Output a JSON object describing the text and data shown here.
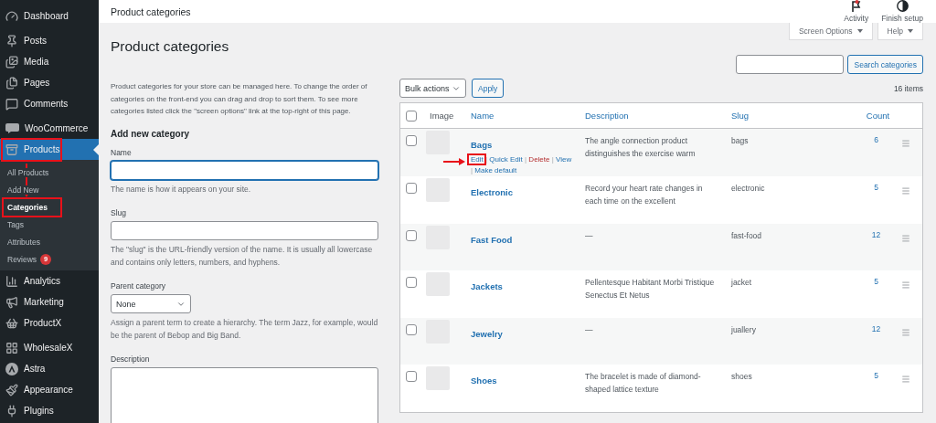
{
  "sidebar": {
    "groups": [
      [
        {
          "label": "Dashboard",
          "kind": "gauge",
          "selected": false,
          "highlighted": false
        }
      ],
      [
        {
          "label": "Posts",
          "kind": "pin",
          "selected": false,
          "highlighted": false
        },
        {
          "label": "Media",
          "kind": "media",
          "selected": false,
          "highlighted": false
        },
        {
          "label": "Pages",
          "kind": "pages",
          "selected": false,
          "highlighted": false
        },
        {
          "label": "Comments",
          "kind": "comment",
          "selected": false,
          "highlighted": false
        }
      ],
      [
        {
          "label": "WooCommerce",
          "kind": "store",
          "selected": false,
          "highlighted": false
        },
        {
          "label": "Products",
          "kind": "archive",
          "selected": true,
          "highlighted": true,
          "children": [
            {
              "label": "All Products",
              "selected": false,
              "highlighted": false
            },
            {
              "label": "Add New",
              "selected": false,
              "highlighted": false
            },
            {
              "label": "Categories",
              "selected": true,
              "highlighted": true
            },
            {
              "label": "Tags",
              "selected": false,
              "highlighted": false
            },
            {
              "label": "Attributes",
              "selected": false,
              "highlighted": false
            },
            {
              "label": "Reviews",
              "selected": false,
              "highlighted": false,
              "badge": "9"
            }
          ]
        },
        {
          "label": "Analytics",
          "kind": "chart",
          "selected": false,
          "highlighted": false
        },
        {
          "label": "Marketing",
          "kind": "megaphone",
          "selected": false,
          "highlighted": false
        },
        {
          "label": "ProductX",
          "kind": "basket",
          "selected": false,
          "highlighted": false
        }
      ],
      [
        {
          "label": "WholesaleX",
          "kind": "grid",
          "selected": false,
          "highlighted": false
        },
        {
          "label": "Astra",
          "kind": "astra",
          "selected": false,
          "highlighted": false
        },
        {
          "label": "Appearance",
          "kind": "brush",
          "selected": false,
          "highlighted": false
        },
        {
          "label": "Plugins",
          "kind": "plug",
          "selected": false,
          "highlighted": false
        }
      ]
    ]
  },
  "header": {
    "title": "Product categories",
    "actions": [
      {
        "label": "Activity",
        "kind": "activity"
      },
      {
        "label": "Finish setup",
        "kind": "setup"
      }
    ]
  },
  "screen_meta": [
    "Screen Options",
    "Help"
  ],
  "page_title": "Product categories",
  "search": {
    "button": "Search categories"
  },
  "intro": "Product categories for your store can be managed here. To change the order of categories on the front-end you can drag and drop to sort them. To see more categories listed click the \"screen options\" link at the top-right of this page.",
  "form": {
    "heading": "Add new category",
    "fields": [
      {
        "kind": "text",
        "label": "Name",
        "hint": "The name is how it appears on your site.",
        "focused": true
      },
      {
        "kind": "text",
        "label": "Slug",
        "hint": "The \"slug\" is the URL-friendly version of the name. It is usually all lowercase and contains only letters, numbers, and hyphens.",
        "focused": false
      },
      {
        "kind": "select",
        "label": "Parent category",
        "value": "None",
        "hint": "Assign a parent term to create a hierarchy. The term Jazz, for example, would be the parent of Bebop and Big Band."
      },
      {
        "kind": "textarea",
        "label": "Description"
      }
    ]
  },
  "table": {
    "select_all_checked": false,
    "bulk_action": "Bulk actions",
    "apply": "Apply",
    "count": "16 items",
    "separator": "|",
    "columns": [
      {
        "label": "Image",
        "sortable": false
      },
      {
        "label": "Name",
        "sortable": true
      },
      {
        "label": "Description",
        "sortable": true
      },
      {
        "label": "Slug",
        "sortable": true
      },
      {
        "label": "Count",
        "sortable": true
      }
    ],
    "rows": [
      {
        "name": "Bags",
        "checked": false,
        "description": "The angle connection product distinguishes the exercise warm",
        "slug": "bags",
        "count": "6",
        "actions": [
          {
            "label": "Edit",
            "kind": "link",
            "highlighted": true
          },
          {
            "label": "Quick Edit",
            "kind": "link",
            "highlighted": false
          },
          {
            "label": "Delete",
            "kind": "delete",
            "highlighted": false
          },
          {
            "label": "View",
            "kind": "link",
            "highlighted": false
          },
          {
            "label": "Make default",
            "kind": "link",
            "highlighted": false
          }
        ]
      },
      {
        "name": "Electronic",
        "checked": false,
        "description": "Record your heart rate changes in each time on the excellent",
        "slug": "electronic",
        "count": "5"
      },
      {
        "name": "Fast Food",
        "checked": false,
        "description": "—",
        "slug": "fast-food",
        "count": "12"
      },
      {
        "name": "Jackets",
        "checked": false,
        "description": "Pellentesque Habitant Morbi Tristique Senectus Et Netus",
        "slug": "jacket",
        "count": "5"
      },
      {
        "name": "Jewelry",
        "checked": false,
        "description": "—",
        "slug": "juallery",
        "count": "12"
      },
      {
        "name": "Shoes",
        "checked": false,
        "description": "The bracelet is made of diamond-shaped lattice texture",
        "slug": "shoes",
        "count": "5"
      }
    ]
  }
}
